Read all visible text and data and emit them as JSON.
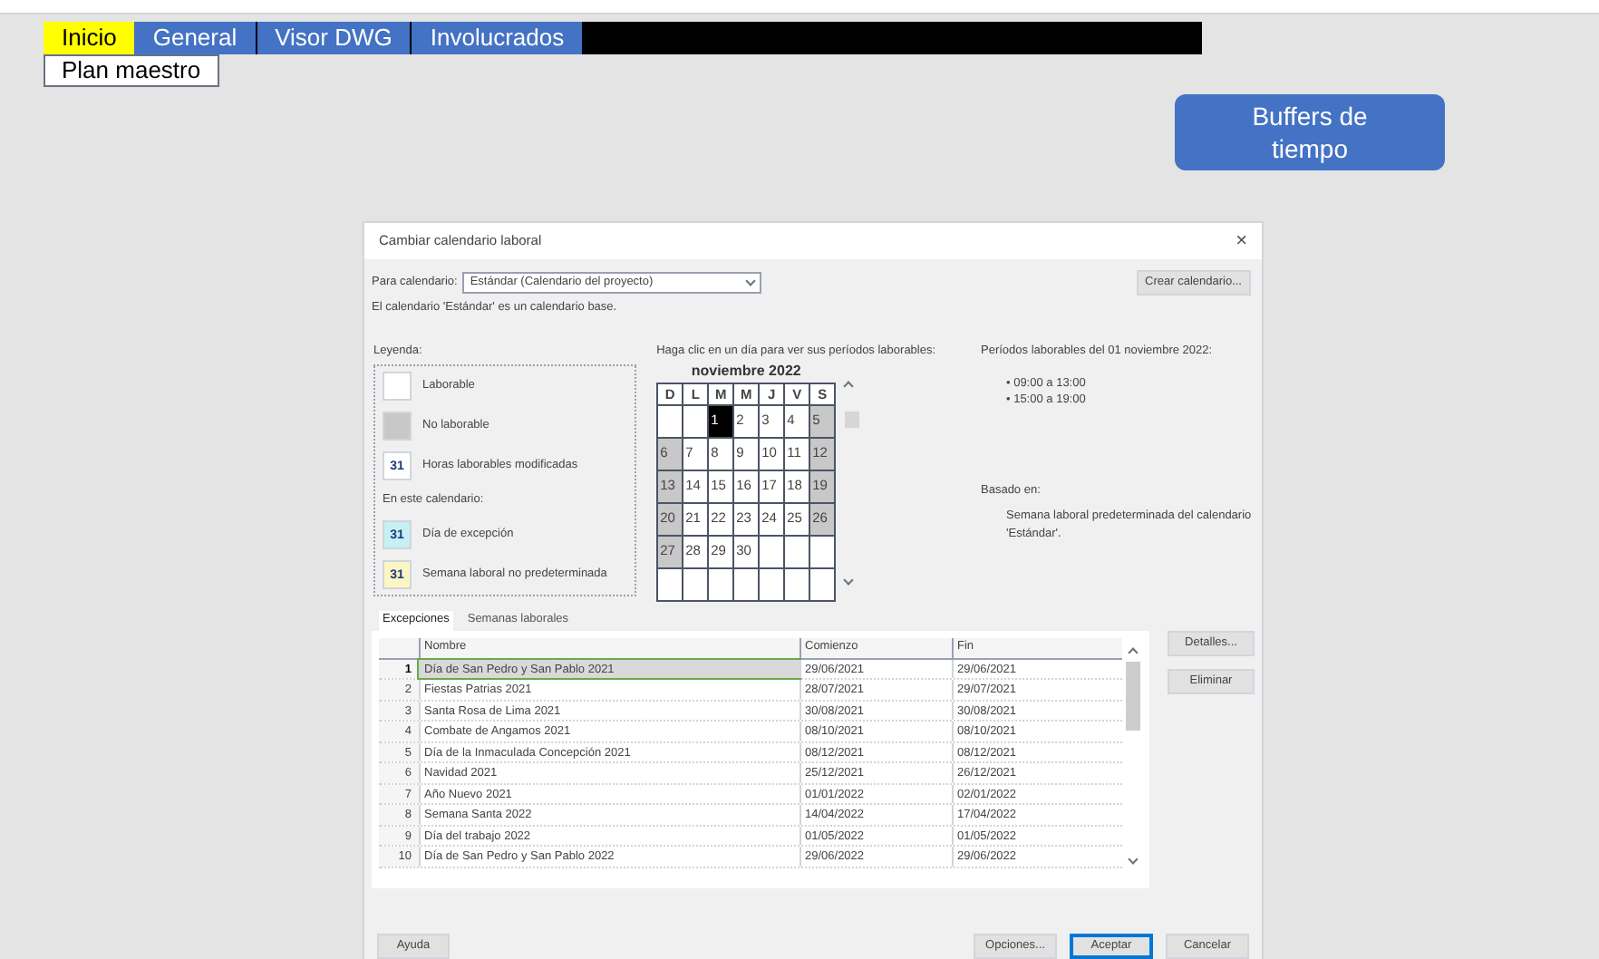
{
  "nav_tabs": [
    {
      "label": "Inicio",
      "selected": true
    },
    {
      "label": "General",
      "selected": false
    },
    {
      "label": "Visor DWG",
      "selected": false
    },
    {
      "label": "Involucrados",
      "selected": false
    }
  ],
  "plan_button": "Plan maestro",
  "buffers_button": "Buffers de tiempo",
  "dialog": {
    "title": "Cambiar calendario laboral",
    "close": "×",
    "calendar_label": "Para calendario:",
    "calendar_value": "Estándar (Calendario del proyecto)",
    "create_button": "Crear calendario...",
    "info": "El calendario 'Estándar' es un calendario base.",
    "legend_title": "Leyenda:",
    "legend": [
      {
        "kind": "working",
        "label": "Laborable"
      },
      {
        "kind": "nonworking",
        "label": "No laborable"
      },
      {
        "kind": "modified",
        "label": "Horas laborables modificadas",
        "mark": "31"
      },
      {
        "kind": "heading",
        "label": "En este calendario:"
      },
      {
        "kind": "exception",
        "label": "Día de excepción",
        "mark": "31"
      },
      {
        "kind": "nondefault",
        "label": "Semana laboral no predeterminada",
        "mark": "31"
      }
    ],
    "calendar_hint": "Haga clic en un día para ver sus períodos laborables:",
    "month": "noviembre 2022",
    "weekdays": [
      "D",
      "L",
      "M",
      "M",
      "J",
      "V",
      "S"
    ],
    "weeks": [
      [
        {
          "working": true
        },
        {
          "working": true
        },
        {
          "day": "1",
          "working": true,
          "selected": true
        },
        {
          "day": "2",
          "working": true,
          "selected": false
        },
        {
          "day": "3",
          "working": true,
          "selected": false
        },
        {
          "day": "4",
          "working": true,
          "selected": false
        },
        {
          "day": "5",
          "working": false,
          "selected": false
        }
      ],
      [
        {
          "day": "6",
          "working": false,
          "selected": false
        },
        {
          "day": "7",
          "working": true,
          "selected": false
        },
        {
          "day": "8",
          "working": true,
          "selected": false
        },
        {
          "day": "9",
          "working": true,
          "selected": false
        },
        {
          "day": "10",
          "working": true,
          "selected": false
        },
        {
          "day": "11",
          "working": true,
          "selected": false
        },
        {
          "day": "12",
          "working": false,
          "selected": false
        }
      ],
      [
        {
          "day": "13",
          "working": false,
          "selected": false
        },
        {
          "day": "14",
          "working": true,
          "selected": false
        },
        {
          "day": "15",
          "working": true,
          "selected": false
        },
        {
          "day": "16",
          "working": true,
          "selected": false
        },
        {
          "day": "17",
          "working": true,
          "selected": false
        },
        {
          "day": "18",
          "working": true,
          "selected": false
        },
        {
          "day": "19",
          "working": false,
          "selected": false
        }
      ],
      [
        {
          "day": "20",
          "working": false,
          "selected": false
        },
        {
          "day": "21",
          "working": true,
          "selected": false
        },
        {
          "day": "22",
          "working": true,
          "selected": false
        },
        {
          "day": "23",
          "working": true,
          "selected": false
        },
        {
          "day": "24",
          "working": true,
          "selected": false
        },
        {
          "day": "25",
          "working": true,
          "selected": false
        },
        {
          "day": "26",
          "working": false,
          "selected": false
        }
      ],
      [
        {
          "day": "27",
          "working": false,
          "selected": false
        },
        {
          "day": "28",
          "working": true,
          "selected": false
        },
        {
          "day": "29",
          "working": true,
          "selected": false
        },
        {
          "day": "30",
          "working": true,
          "selected": false
        },
        {
          "working": true
        },
        {
          "working": true
        },
        {
          "working": true
        }
      ],
      [
        {
          "working": true
        },
        {
          "working": true
        },
        {
          "working": true
        },
        {
          "working": true
        },
        {
          "working": true
        },
        {
          "working": true
        },
        {
          "working": true
        }
      ]
    ],
    "periods_title": "Períodos laborables del 01 noviembre 2022:",
    "periods": [
      "• 09:00 a 13:00",
      "• 15:00 a 19:00"
    ],
    "based_label": "Basado en:",
    "based_text": "Semana laboral predeterminada del calendario 'Estándar'.",
    "tabs": [
      {
        "label": "Excepciones",
        "selected": true
      },
      {
        "label": "Semanas laborales",
        "selected": false
      }
    ],
    "columns": [
      "Nombre",
      "Comienzo",
      "Fin"
    ],
    "rows": [
      {
        "num": "1",
        "name": "Día de San Pedro y San Pablo 2021",
        "start": "29/06/2021",
        "end": "29/06/2021",
        "selected": true
      },
      {
        "num": "2",
        "name": "Fiestas Patrias 2021",
        "start": "28/07/2021",
        "end": "29/07/2021",
        "selected": false
      },
      {
        "num": "3",
        "name": "Santa Rosa de Lima 2021",
        "start": "30/08/2021",
        "end": "30/08/2021",
        "selected": false
      },
      {
        "num": "4",
        "name": "Combate de Angamos 2021",
        "start": "08/10/2021",
        "end": "08/10/2021",
        "selected": false
      },
      {
        "num": "5",
        "name": "Día de la Inmaculada Concepción 2021",
        "start": "08/12/2021",
        "end": "08/12/2021",
        "selected": false
      },
      {
        "num": "6",
        "name": "Navidad 2021",
        "start": "25/12/2021",
        "end": "26/12/2021",
        "selected": false
      },
      {
        "num": "7",
        "name": "Año Nuevo 2021",
        "start": "01/01/2022",
        "end": "02/01/2022",
        "selected": false
      },
      {
        "num": "8",
        "name": "Semana Santa 2022",
        "start": "14/04/2022",
        "end": "17/04/2022",
        "selected": false
      },
      {
        "num": "9",
        "name": "Día del trabajo 2022",
        "start": "01/05/2022",
        "end": "01/05/2022",
        "selected": false
      },
      {
        "num": "10",
        "name": "Día de San Pedro y San Pablo 2022",
        "start": "29/06/2022",
        "end": "29/06/2022",
        "selected": false
      }
    ],
    "side_buttons": [
      "Detalles...",
      "Eliminar"
    ],
    "help_button": "Ayuda",
    "buttons": [
      {
        "label": "Opciones...",
        "default": false
      },
      {
        "label": "Aceptar",
        "default": true
      },
      {
        "label": "Cancelar",
        "default": false
      }
    ]
  }
}
